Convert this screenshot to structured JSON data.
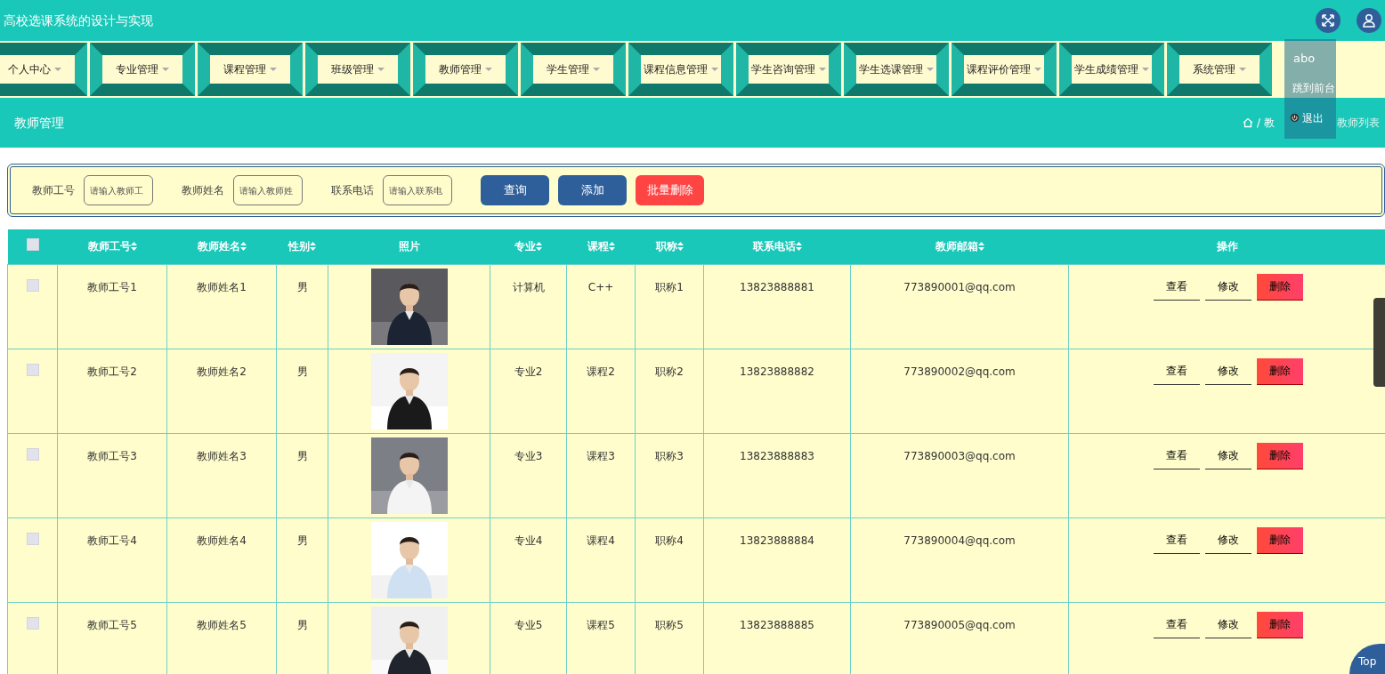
{
  "app_title": "高校选课系统的设计与实现",
  "user_menu": {
    "username": "abo",
    "items": [
      "跳到前台",
      "退出"
    ]
  },
  "nav": [
    {
      "label": "个人中心"
    },
    {
      "label": "专业管理"
    },
    {
      "label": "课程管理"
    },
    {
      "label": "班级管理"
    },
    {
      "label": "教师管理"
    },
    {
      "label": "学生管理"
    },
    {
      "label": "课程信息管理"
    },
    {
      "label": "学生咨询管理"
    },
    {
      "label": "学生选课管理"
    },
    {
      "label": "课程评价管理"
    },
    {
      "label": "学生成绩管理"
    },
    {
      "label": "系统管理"
    }
  ],
  "page_title": "教师管理",
  "breadcrumb_separator": "/",
  "breadcrumb": [
    "教",
    "教师列表"
  ],
  "search": {
    "fields": [
      {
        "label": "教师工号",
        "placeholder": "请输入教师工"
      },
      {
        "label": "教师姓名",
        "placeholder": "请输入教师姓"
      },
      {
        "label": "联系电话",
        "placeholder": "请输入联系电"
      }
    ],
    "buttons": [
      {
        "label": "查询",
        "kind": "primary"
      },
      {
        "label": "添加",
        "kind": "primary"
      },
      {
        "label": "批量删除",
        "kind": "danger"
      }
    ]
  },
  "table": {
    "select_all_checked": false,
    "columns": [
      {
        "label": "教师工号",
        "kind": "text",
        "sortable": true
      },
      {
        "label": "教师姓名",
        "kind": "text",
        "sortable": true
      },
      {
        "label": "性别",
        "kind": "text",
        "sortable": true
      },
      {
        "label": "照片",
        "sortable": false
      },
      {
        "label": "专业",
        "kind": "text",
        "sortable": true
      },
      {
        "label": "课程",
        "kind": "text",
        "sortable": true
      },
      {
        "label": "职称",
        "kind": "text",
        "sortable": true
      },
      {
        "label": "联系电话",
        "kind": "text",
        "sortable": true
      },
      {
        "label": "教师邮箱",
        "kind": "text",
        "sortable": true
      },
      {
        "label": "操作",
        "kind": "actions",
        "sortable": false
      }
    ],
    "rows": [
      {
        "checked": false,
        "cells": [
          "教师工号1",
          "教师姓名1",
          "男",
          {
            "kind": "picture"
          },
          "计算机",
          "C++",
          "职称1",
          "13823888881",
          "773890001@qq.com"
        ],
        "actions": [
          {
            "label": "查看",
            "kind": "link"
          },
          {
            "label": "修改",
            "kind": "link"
          },
          {
            "label": "删除",
            "kind": "danger"
          }
        ]
      },
      {
        "checked": false,
        "cells": [
          "教师工号2",
          "教师姓名2",
          "男",
          {
            "kind": "picture"
          },
          "专业2",
          "课程2",
          "职称2",
          "13823888882",
          "773890002@qq.com"
        ],
        "actions": [
          {
            "label": "查看",
            "kind": "link"
          },
          {
            "label": "修改",
            "kind": "link"
          },
          {
            "label": "删除",
            "kind": "danger"
          }
        ]
      },
      {
        "checked": false,
        "cells": [
          "教师工号3",
          "教师姓名3",
          "男",
          {
            "kind": "picture"
          },
          "专业3",
          "课程3",
          "职称3",
          "13823888883",
          "773890003@qq.com"
        ],
        "actions": [
          {
            "label": "查看",
            "kind": "link"
          },
          {
            "label": "修改",
            "kind": "link"
          },
          {
            "label": "删除",
            "kind": "danger"
          }
        ]
      },
      {
        "checked": false,
        "cells": [
          "教师工号4",
          "教师姓名4",
          "男",
          {
            "kind": "picture"
          },
          "专业4",
          "课程4",
          "职称4",
          "13823888884",
          "773890004@qq.com"
        ],
        "actions": [
          {
            "label": "查看",
            "kind": "link"
          },
          {
            "label": "修改",
            "kind": "link"
          },
          {
            "label": "删除",
            "kind": "danger"
          }
        ]
      },
      {
        "checked": false,
        "cells": [
          "教师工号5",
          "教师姓名5",
          "男",
          {
            "kind": "picture"
          },
          "专业5",
          "课程5",
          "职称5",
          "13823888885",
          "773890005@qq.com"
        ],
        "actions": [
          {
            "label": "查看",
            "kind": "link"
          },
          {
            "label": "修改",
            "kind": "link"
          },
          {
            "label": "删除",
            "kind": "danger"
          }
        ]
      }
    ]
  },
  "back_to_top": "Top"
}
